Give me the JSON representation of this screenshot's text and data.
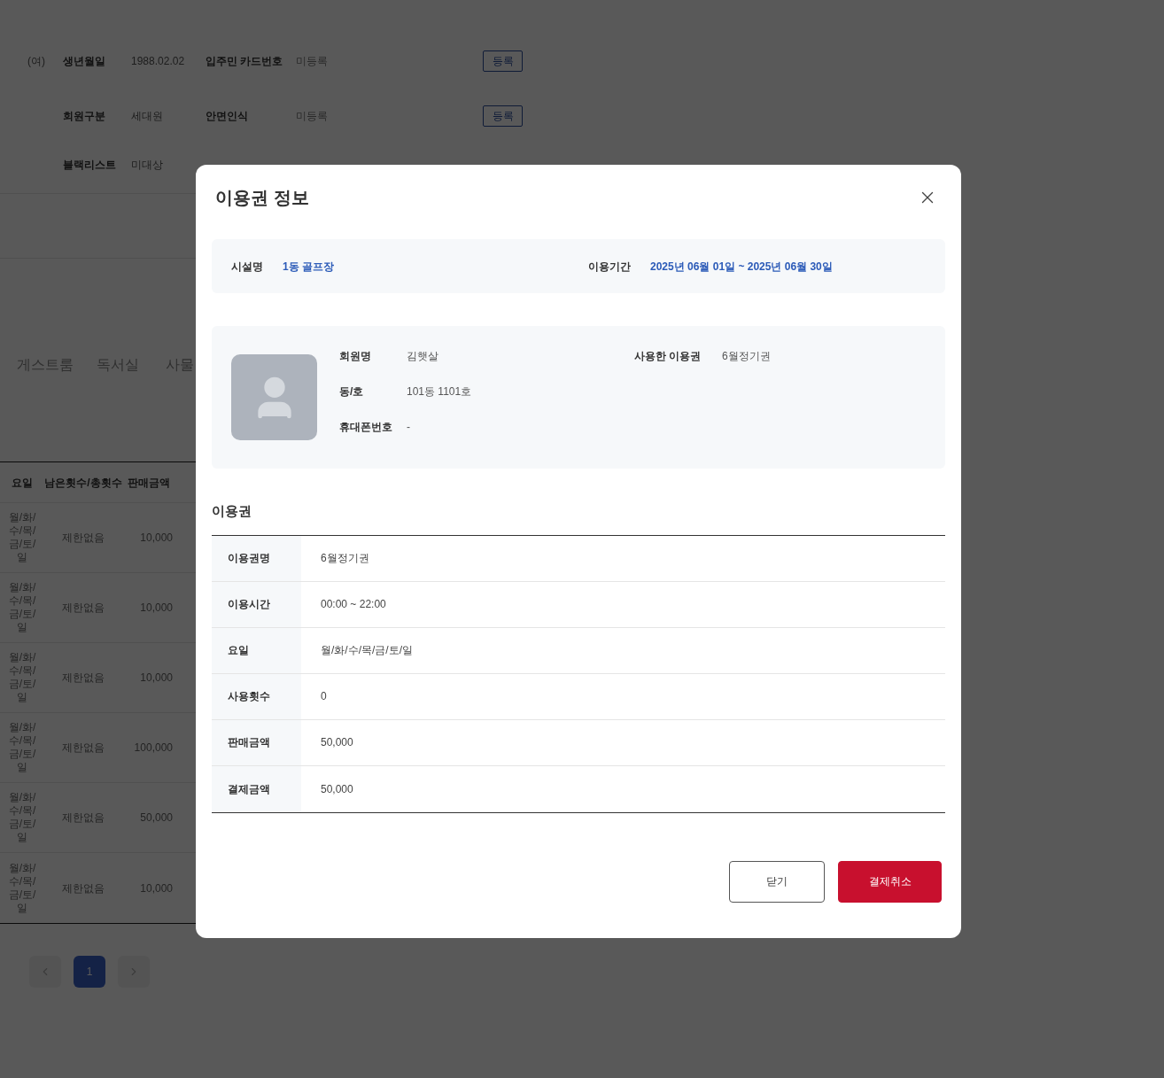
{
  "background": {
    "member_rows": [
      {
        "prefix": "(여)",
        "label": "생년월일",
        "value": "1988.02.02",
        "label2": "입주민 카드번호",
        "value2": "미등록",
        "button": "등록"
      },
      {
        "label": "회원구분",
        "value": "세대원",
        "label2": "안면인식",
        "value2": "미등록",
        "button": "등록"
      },
      {
        "label": "블랙리스트",
        "value": "미대상"
      }
    ],
    "tabs": [
      "게스트룸",
      "독서실",
      "사물"
    ],
    "table": {
      "columns": [
        "요일",
        "남은횟수/총횟수",
        "판매금액"
      ],
      "rows": [
        [
          "월/화/수/목/금/토/일",
          "제한없음",
          "10,000"
        ],
        [
          "월/화/수/목/금/토/일",
          "제한없음",
          "10,000"
        ],
        [
          "월/화/수/목/금/토/일",
          "제한없음",
          "10,000"
        ],
        [
          "월/화/수/목/금/토/일",
          "제한없음",
          "100,000"
        ],
        [
          "월/화/수/목/금/토/일",
          "제한없음",
          "50,000"
        ],
        [
          "월/화/수/목/금/토/일",
          "제한없음",
          "10,000"
        ]
      ]
    },
    "pagination": {
      "pages": [
        {
          "label": "1",
          "selected": true
        }
      ]
    }
  },
  "modal": {
    "title": "이용권 정보",
    "facility": {
      "label": "시설명",
      "value": "1동 골프장"
    },
    "period": {
      "label": "이용기간",
      "value": "2025년 06월 01일 ~ 2025년 06월 30일"
    },
    "member_left": [
      {
        "label": "회원명",
        "value": "김햇살"
      },
      {
        "label": "동/호",
        "value": "101동 1101호"
      },
      {
        "label": "휴대폰번호",
        "value": "-"
      }
    ],
    "member_right": [
      {
        "label": "사용한 이용권",
        "value": "6월정기권"
      }
    ],
    "section_title": "이용권",
    "ticket_rows": [
      {
        "label": "이용권명",
        "value": "6월정기권"
      },
      {
        "label": "이용시간",
        "value": "00:00 ~ 22:00"
      },
      {
        "label": "요일",
        "value": "월/화/수/목/금/토/일"
      },
      {
        "label": "사용횟수",
        "value": "0"
      },
      {
        "label": "판매금액",
        "value": "50,000"
      },
      {
        "label": "결제금액",
        "value": "50,000"
      }
    ],
    "buttons": [
      {
        "label": "닫기",
        "kind": "secondary"
      },
      {
        "label": "결제취소",
        "kind": "primary"
      }
    ]
  }
}
